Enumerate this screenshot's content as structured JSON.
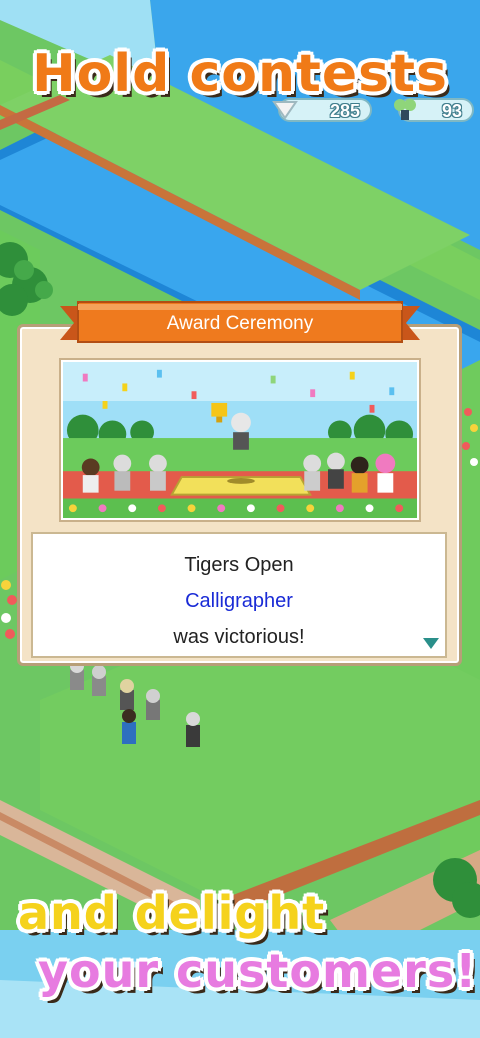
{
  "headline": {
    "top": "Hold contests",
    "bottom_line1": "and delight",
    "bottom_line2": "your customers!"
  },
  "hud": {
    "hearts_value": "285",
    "fans_value": "93"
  },
  "dialog": {
    "title": "Award Ceremony",
    "message_line1": "Tigers Open",
    "message_line2": "Calligrapher",
    "message_line3": "was victorious!"
  },
  "colors": {
    "headline_top": "#f07a17",
    "headline_line1": "#f5d21c",
    "headline_line2": "#e77be0",
    "banner": "#ef7a1e",
    "highlight_name": "#1a2bd6"
  }
}
